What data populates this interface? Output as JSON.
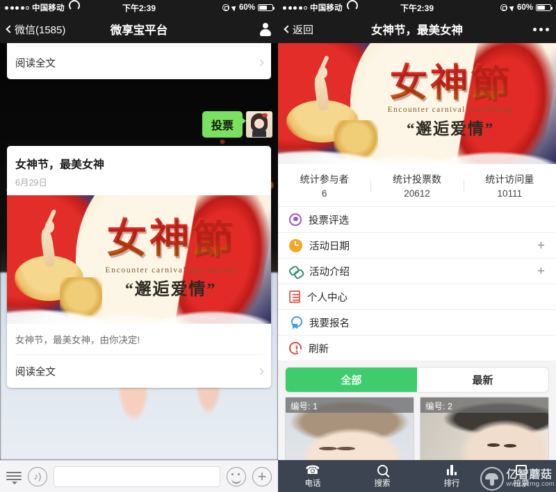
{
  "left": {
    "status_bar": {
      "carrier": "中国移动",
      "wifi_icon": "wifi-icon",
      "time": "下午2:39",
      "lock_icon": "rotation-lock-icon",
      "location_icon": "location-arrow-icon",
      "battery_percent": "60%",
      "battery_icon": "battery-icon"
    },
    "nav": {
      "back_label": "微信(1585)",
      "back_icon": "chevron-left-icon",
      "title": "微享宝平台",
      "right_icon": "contact-person-icon"
    },
    "top_card": {
      "read_more": "阅读全文",
      "chevron_icon": "chevron-right-icon"
    },
    "timestamp": "下午2:39",
    "message": {
      "bubble_text": "投票",
      "avatar_icon": "user-avatar"
    },
    "article_card": {
      "title": "女神节，最美女神",
      "date": "6月29日",
      "description": "女神节，最美女神，由你决定!",
      "read_more": "阅读全文",
      "chevron_icon": "chevron-right-icon"
    },
    "input_bar": {
      "menu_icon": "keyboard-menu-icon",
      "voice_icon": "voice-message-icon",
      "input_value": "",
      "input_placeholder": "",
      "emoji_icon": "smiley-face-icon",
      "plus_icon": "plus-icon"
    }
  },
  "right": {
    "status_bar": {
      "carrier": "中国移动",
      "wifi_icon": "wifi-icon",
      "time": "下午2:39",
      "lock_icon": "rotation-lock-icon",
      "location_icon": "location-arrow-icon",
      "battery_percent": "60%",
      "battery_icon": "battery-icon"
    },
    "nav": {
      "back_label": "返回",
      "back_icon": "chevron-left-icon",
      "title": "女神节，最美女神",
      "right_icon": "more-ellipsis-icon"
    },
    "stats": [
      {
        "label": "统计参与者",
        "value": "6"
      },
      {
        "label": "统计投票数",
        "value": "20612"
      },
      {
        "label": "统计访问量",
        "value": "10111"
      }
    ],
    "menu": [
      {
        "label": "投票评选",
        "icon": "heart-vote-icon",
        "color": "#9b59c7",
        "expand": ""
      },
      {
        "label": "活动日期",
        "icon": "clock-icon",
        "color": "#f5a623",
        "expand": "+"
      },
      {
        "label": "活动介绍",
        "icon": "link-chain-icon",
        "color": "#2f8f6e",
        "expand": "+"
      },
      {
        "label": "个人中心",
        "icon": "document-list-icon",
        "color": "#e8655b",
        "expand": ""
      },
      {
        "label": "我要报名",
        "icon": "ribbon-badge-icon",
        "color": "#3f9fe0",
        "expand": ""
      },
      {
        "label": "刷新",
        "icon": "refresh-icon",
        "color": "#d94c3d",
        "expand": ""
      }
    ],
    "tabs": [
      {
        "label": "全部",
        "active": true
      },
      {
        "label": "最新",
        "active": false
      }
    ],
    "photos": [
      {
        "label": "编号: 1"
      },
      {
        "label": "编号: 2"
      }
    ],
    "tabbar": [
      {
        "label": "电话",
        "icon": "phone-icon"
      },
      {
        "label": "搜索",
        "icon": "search-icon"
      },
      {
        "label": "排行",
        "icon": "ranking-bars-icon"
      },
      {
        "label": "拉票",
        "icon": "solicit-votes-icon"
      }
    ],
    "watermark": {
      "name": "亿智蘑菇",
      "url": "www.yzmg.com",
      "logo_icon": "mushroom-logo-icon"
    }
  },
  "poster": {
    "title": "女神節",
    "subtitle_en": "Encounter carnival purchasing",
    "subtitle_cn": "“邂逅爱情”"
  },
  "colors": {
    "wechat_green": "#7ae05f",
    "tab_green": "#3ecc6d",
    "navbar_dark": "#1b1b1b",
    "tabbar_slate": "#3b4450"
  }
}
